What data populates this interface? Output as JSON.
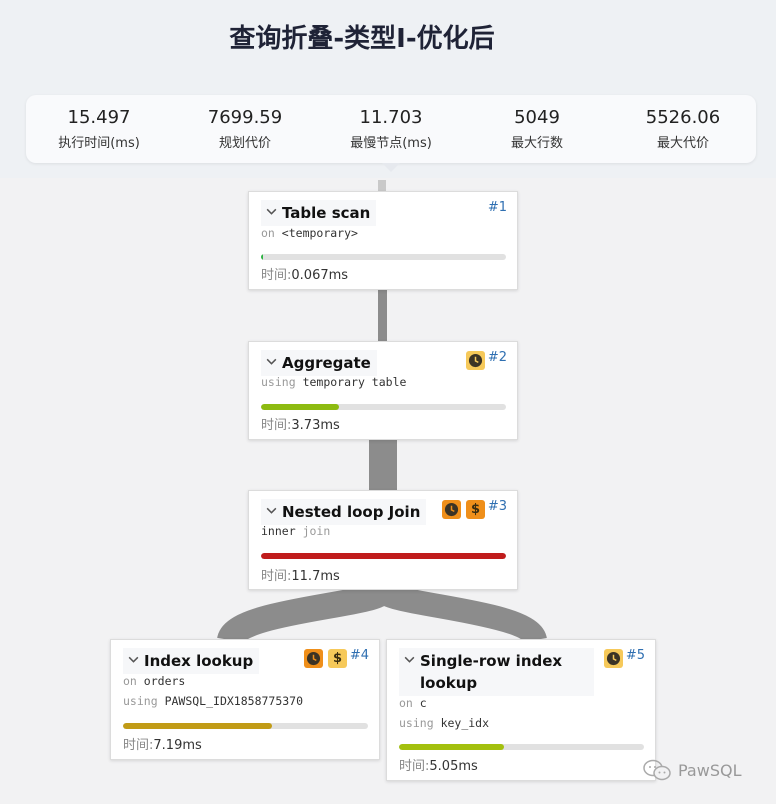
{
  "title": "查询折叠-类型I-优化后",
  "stats": [
    {
      "value": "15.497",
      "label": "执行时间(ms)"
    },
    {
      "value": "7699.59",
      "label": "规划代价"
    },
    {
      "value": "11.703",
      "label": "最慢节点(ms)"
    },
    {
      "value": "5049",
      "label": "最大行数"
    },
    {
      "value": "5526.06",
      "label": "最大代价"
    }
  ],
  "time_label": "时间:",
  "nodes": [
    {
      "title": "Table scan",
      "id": "#1",
      "kw": "on",
      "value": "<temporary>",
      "progress": 0.01,
      "color": "#2fb344",
      "time": "0.067ms"
    },
    {
      "title": "Aggregate",
      "id": "#2",
      "kw": "using",
      "value": "temporary table",
      "progress": 0.32,
      "color": "#8dbb11",
      "time": "3.73ms"
    },
    {
      "title": "Nested loop Join",
      "id": "#3",
      "kw": "inner",
      "value": "join",
      "progress": 1.0,
      "color": "#c01c1c",
      "time": "11.7ms"
    },
    {
      "title": "Index lookup",
      "id": "#4",
      "kw": "on",
      "value": "orders",
      "kw2": "using",
      "value2": "PAWSQL_IDX1858775370",
      "progress": 0.61,
      "color": "#c19b16",
      "time": "7.19ms"
    },
    {
      "title": "Single-row index lookup",
      "id": "#5",
      "kw": "on",
      "value": "c",
      "kw2": "using",
      "value2": "key_idx",
      "progress": 0.43,
      "color": "#a3c00e",
      "time": "5.05ms"
    }
  ],
  "colors": {
    "edge": "#8c8c8c",
    "id": "#2f6fb1",
    "badge_yellow": "#f6c95a",
    "badge_orange": "#ef8f1a"
  },
  "icons": [
    "chevron-down-icon",
    "clock-icon",
    "dollar-icon",
    "wechat-icon"
  ],
  "watermark": "PawSQL"
}
